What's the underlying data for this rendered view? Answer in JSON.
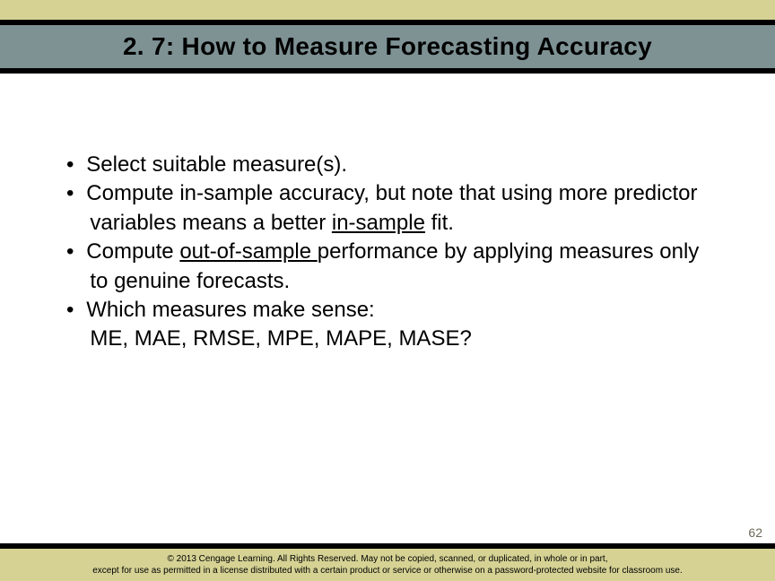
{
  "header": {
    "title": "2. 7: How to Measure Forecasting Accuracy"
  },
  "content": {
    "b1": "Select suitable measure(s).",
    "b2_part1": "Compute in-sample accuracy, but note that using more predictor variables means a better ",
    "b2_underlined": "in-sample",
    "b2_part2": " fit.",
    "b3_part1": "Compute ",
    "b3_underlined": "out-of-sample ",
    "b3_part2": "performance by applying measures only to genuine forecasts.",
    "b4": "Which measures make sense:",
    "b4_sub": "ME, MAE, RMSE, MPE, MAPE, MASE?"
  },
  "page_number": "62",
  "footer": {
    "line1": "© 2013 Cengage Learning. All Rights Reserved. May not be copied, scanned, or duplicated, in whole or in part,",
    "line2": "except for use as permitted in a license distributed with a certain product or service or otherwise on a password-protected website for classroom use."
  }
}
